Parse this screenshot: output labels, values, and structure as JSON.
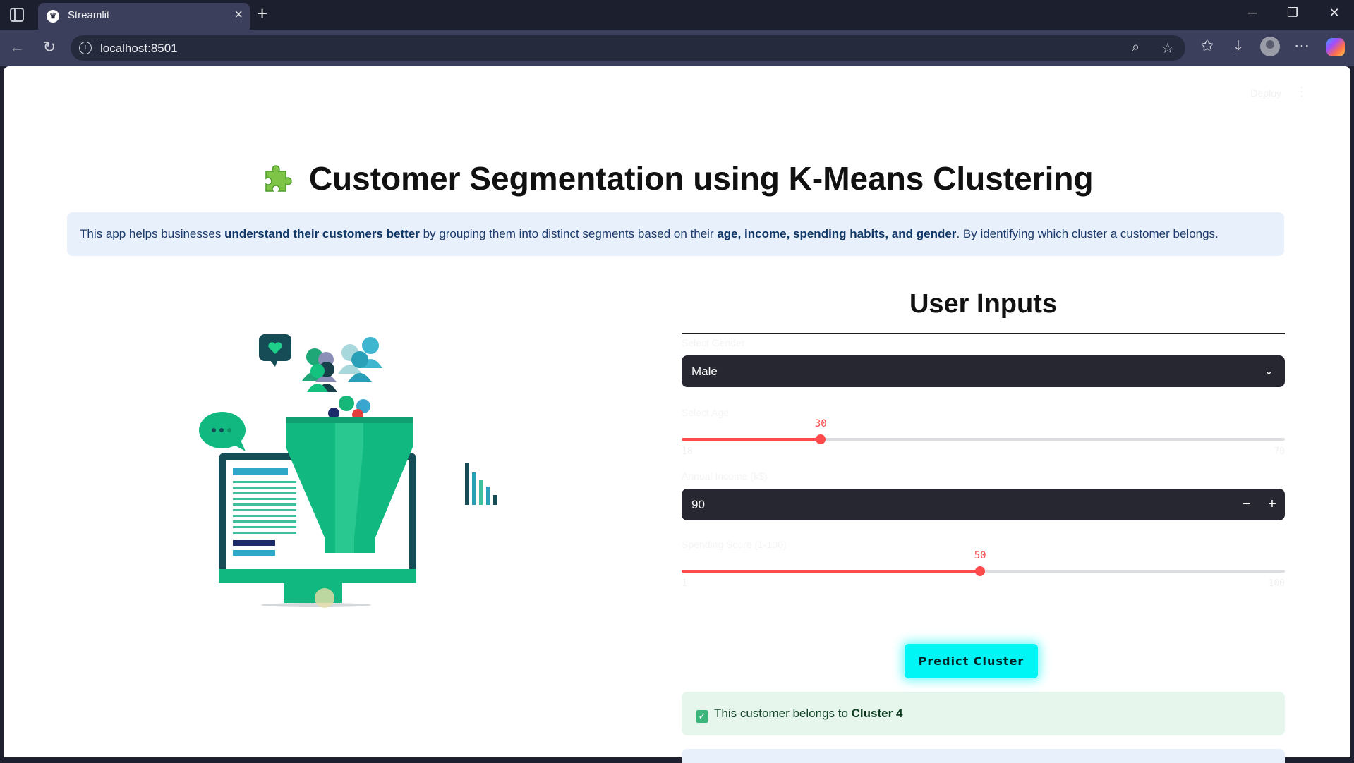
{
  "browser": {
    "tab_title": "Streamlit",
    "tab_favicon": "♛",
    "url": "localhost:8501"
  },
  "page": {
    "deploy_label": "Deploy",
    "title": "Customer Segmentation using K-Means Clustering",
    "info_pre": "This app helps businesses ",
    "info_b1": "understand their customers better",
    "info_mid": " by grouping them into distinct segments based on their ",
    "info_b2": "age, income, spending habits, and gender",
    "info_post": ". By identifying which cluster a customer belongs."
  },
  "inputs": {
    "section_title": "User Inputs",
    "gender": {
      "label": "Select Gender",
      "value": "Male"
    },
    "age": {
      "label": "Select Age",
      "value": 30,
      "min": 18,
      "max": 70
    },
    "income": {
      "label": "Annual Income (k$)",
      "value": "90",
      "minus": "−",
      "plus": "+"
    },
    "spending": {
      "label": "Spending Score (1-100)",
      "value": 50,
      "min": 1,
      "max": 100
    }
  },
  "predict_button": "Predict Cluster",
  "result": {
    "prefix": "This customer belongs to ",
    "cluster": "Cluster 4"
  },
  "colors": {
    "accent": "#ff4b4b",
    "button": "#00f5f5",
    "info_bg": "#e8f0fb",
    "success_bg": "#e7f6ec"
  }
}
